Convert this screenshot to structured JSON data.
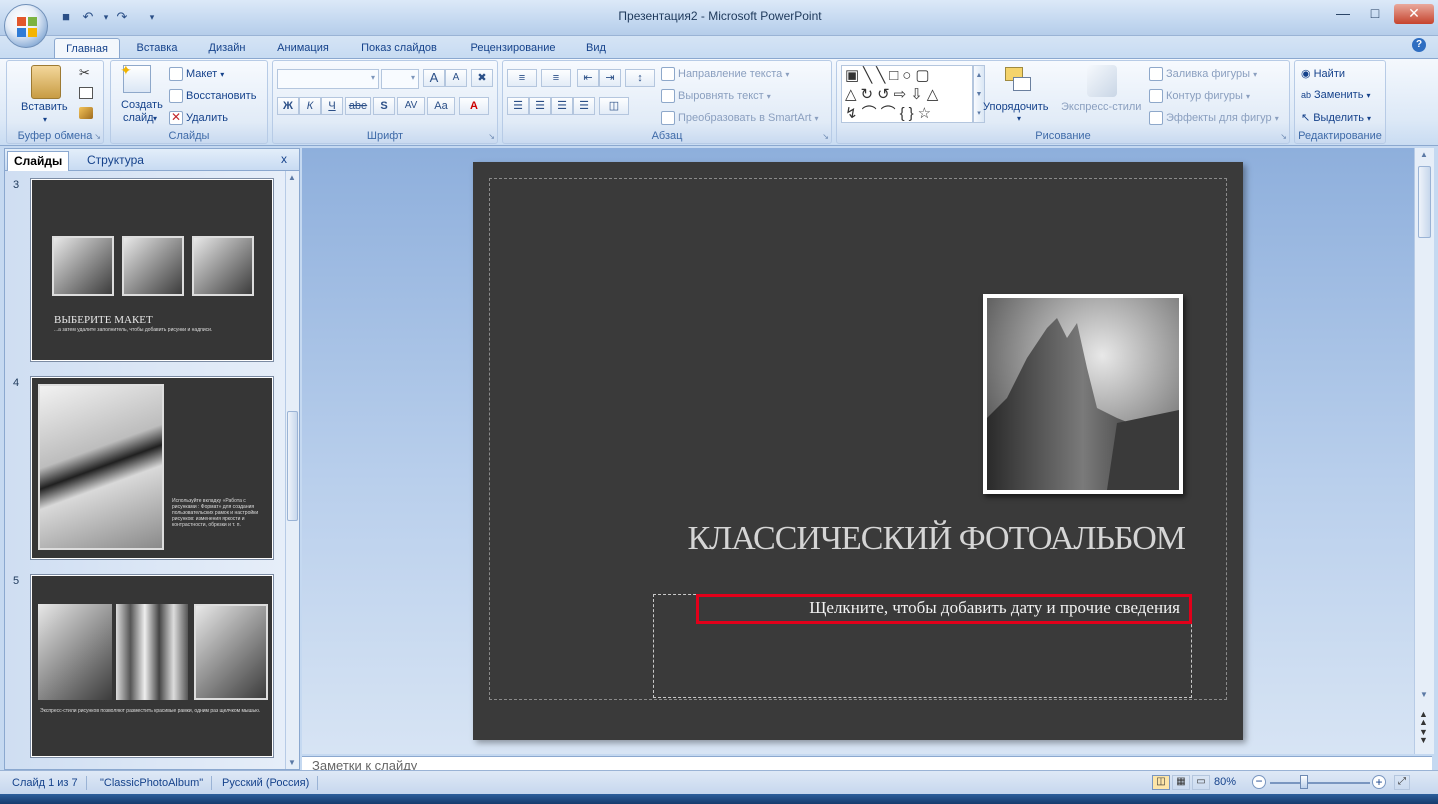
{
  "window": {
    "title": "Презентация2 - Microsoft PowerPoint"
  },
  "tabs": [
    "Главная",
    "Вставка",
    "Дизайн",
    "Анимация",
    "Показ слайдов",
    "Рецензирование",
    "Вид"
  ],
  "ribbon": {
    "clipboard": {
      "label": "Буфер обмена",
      "paste": "Вставить"
    },
    "slides": {
      "label": "Слайды",
      "new_slide_1": "Создать",
      "new_slide_2": "слайд",
      "layout": "Макет",
      "reset": "Восстановить",
      "delete": "Удалить"
    },
    "font": {
      "label": "Шрифт",
      "bold": "Ж",
      "italic": "К",
      "underline": "Ч",
      "strike": "abe",
      "shadow": "S",
      "spacing": "AV",
      "case": "Aa",
      "grow": "A",
      "shrink": "A"
    },
    "paragraph": {
      "label": "Абзац",
      "text_direction": "Направление текста",
      "align_text": "Выровнять текст",
      "smartart": "Преобразовать в SmartArt"
    },
    "drawing": {
      "label": "Рисование",
      "arrange": "Упорядочить",
      "quick_styles": "Экспресс-стили",
      "fill": "Заливка фигуры",
      "outline": "Контур фигуры",
      "effects": "Эффекты для фигур"
    },
    "editing": {
      "label": "Редактирование",
      "find": "Найти",
      "replace": "Заменить",
      "select": "Выделить"
    }
  },
  "panel": {
    "tab_slides": "Слайды",
    "tab_outline": "Структура",
    "close": "x"
  },
  "thumbs": [
    {
      "num": "3",
      "title": "ВЫБЕРИТЕ МАКЕТ",
      "text": "...а затем удалите заполнитель, чтобы добавить рисунки и надписи."
    },
    {
      "num": "4",
      "text": "Используйте вкладку «Работа с рисунками : Формат» для создания пользовательских рамок и настройки рисунков: изменения яркости и контрастности, обрезки и т. п."
    },
    {
      "num": "5",
      "text": "Экспресс-стили рисунков позволяют разместить красивые рамки, одним раз щелчком мышью."
    }
  ],
  "slide": {
    "title": "КЛАССИЧЕСКИЙ ФОТОАЛЬБОМ",
    "subtitle": "Щелкните, чтобы добавить дату и прочие сведения"
  },
  "notes": {
    "placeholder": "Заметки к слайду"
  },
  "status": {
    "slide": "Слайд 1 из 7",
    "theme": "\"ClassicPhotoAlbum\"",
    "lang": "Русский (Россия)",
    "zoom": "80%"
  },
  "colors": {
    "highlight": "#e2001a",
    "slide_bg": "#3a3a3a"
  }
}
